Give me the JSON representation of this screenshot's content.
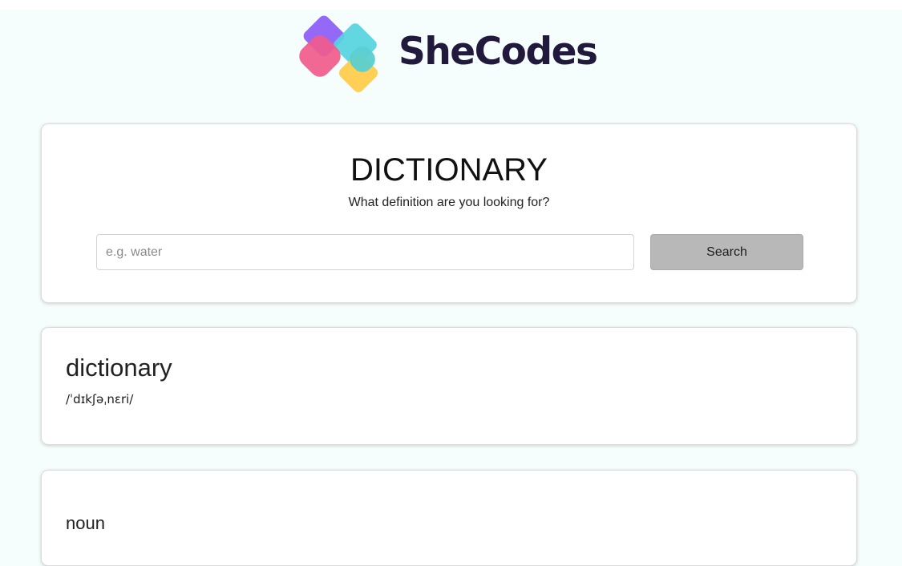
{
  "logo": {
    "wordmark": "SheCodes",
    "colors": {
      "purple": "#8b5cf6",
      "pink": "#f05b8c",
      "cyan": "#4fd6e2",
      "yellow": "#ffcc4d",
      "text": "#211a3d"
    }
  },
  "search_card": {
    "title": "DICTIONARY",
    "subtitle": "What definition are you looking for?",
    "input_placeholder": "e.g. water",
    "input_value": "",
    "button_label": "Search"
  },
  "result": {
    "word": "dictionary",
    "phonetic": "/ˈdɪkʃəˌnɛri/"
  },
  "meaning": {
    "part_of_speech": "noun"
  }
}
